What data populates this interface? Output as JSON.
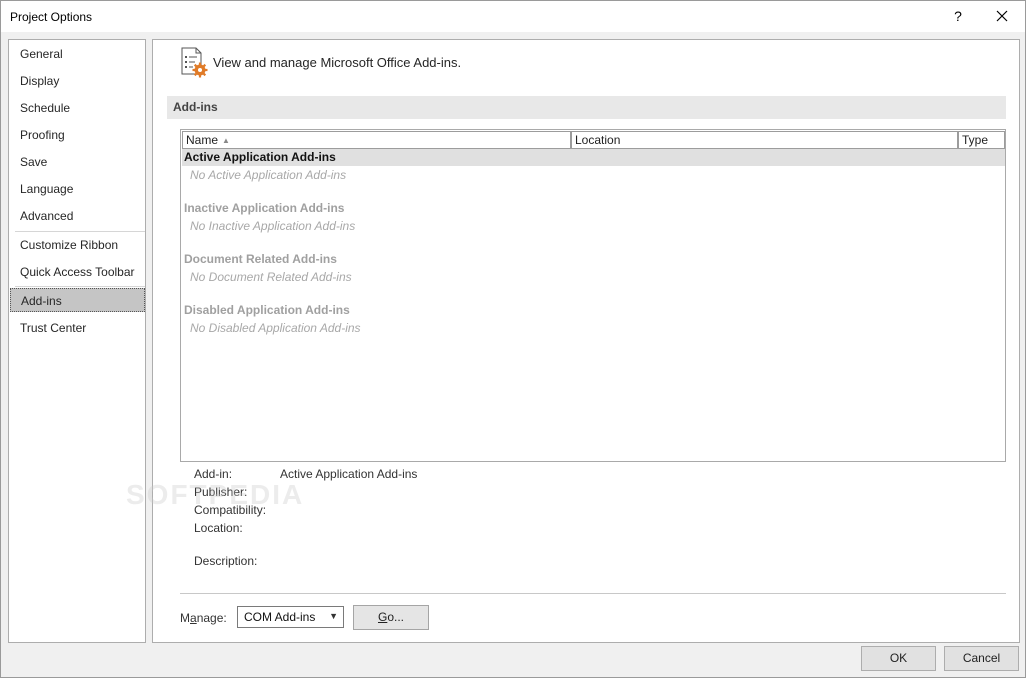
{
  "window": {
    "title": "Project Options",
    "help_glyph": "?"
  },
  "sidebar": {
    "items": [
      {
        "label": "General"
      },
      {
        "label": "Display"
      },
      {
        "label": "Schedule"
      },
      {
        "label": "Proofing"
      },
      {
        "label": "Save"
      },
      {
        "label": "Language"
      },
      {
        "label": "Advanced"
      },
      {
        "label": "Customize Ribbon"
      },
      {
        "label": "Quick Access Toolbar"
      },
      {
        "label": "Add-ins",
        "selected": true
      },
      {
        "label": "Trust Center"
      }
    ]
  },
  "content": {
    "header_text": "View and manage Microsoft Office Add-ins.",
    "section_title": "Add-ins",
    "columns": {
      "name": "Name",
      "location": "Location",
      "type": "Type"
    },
    "groups": [
      {
        "title": "Active Application Add-ins",
        "empty": "No Active Application Add-ins"
      },
      {
        "title": "Inactive Application Add-ins",
        "empty": "No Inactive Application Add-ins"
      },
      {
        "title": "Document Related Add-ins",
        "empty": "No Document Related Add-ins"
      },
      {
        "title": "Disabled Application Add-ins",
        "empty": "No Disabled Application Add-ins"
      }
    ],
    "details": {
      "addin_label": "Add-in:",
      "addin_value": "Active Application Add-ins",
      "publisher_label": "Publisher:",
      "compatibility_label": "Compatibility:",
      "location_label": "Location:",
      "description_label": "Description:"
    },
    "manage": {
      "label_prefix": "M",
      "label_underlined": "a",
      "label_suffix": "nage:",
      "selected": "COM Add-ins",
      "go_underlined": "G",
      "go_suffix": "o..."
    }
  },
  "buttons": {
    "ok": "OK",
    "cancel": "Cancel"
  },
  "watermark": "SOFTPEDIA",
  "colors": {
    "icon_accent": "#e07b28",
    "selected_nav": "#c5c5c5",
    "active_group_band": "#e0e0e0"
  }
}
